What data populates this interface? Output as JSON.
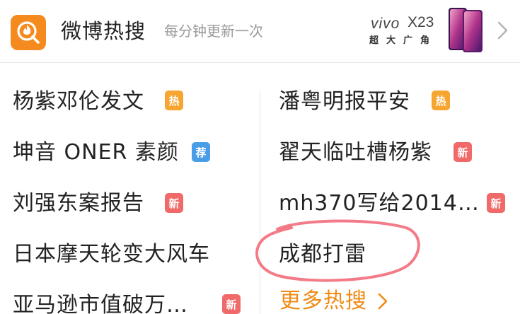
{
  "header": {
    "title": "微博热搜",
    "subtitle": "每分钟更新一次",
    "logo_icon": "weibo-search-flame-icon",
    "accent": "#f58a1f",
    "ad": {
      "brand": "vivo",
      "model": "X23",
      "tagline": "超大广角"
    }
  },
  "left_items": [
    {
      "text": "杨紫邓伦发文",
      "badge": "热",
      "badge_type": "hot"
    },
    {
      "text": "坤音 ONER 素颜",
      "badge": "荐",
      "badge_type": "rec"
    },
    {
      "text": "刘强东案报告",
      "badge": "新",
      "badge_type": "new"
    },
    {
      "text": "日本摩天轮变大风车",
      "badge": "",
      "badge_type": ""
    },
    {
      "text": "亚马逊市值破万…",
      "badge": "新",
      "badge_type": "new"
    }
  ],
  "right_items": [
    {
      "text": "潘粤明报平安",
      "badge": "热",
      "badge_type": "hot"
    },
    {
      "text": "翟天临吐槽杨紫",
      "badge": "新",
      "badge_type": "new"
    },
    {
      "text": "mh370写给2014…",
      "badge": "新",
      "badge_type": "new"
    },
    {
      "text": "成都打雷",
      "badge": "",
      "badge_type": ""
    }
  ],
  "more_label": "更多热搜",
  "colors": {
    "hot": "#f7a531",
    "rec": "#4a9ee8",
    "new": "#f06a6a",
    "more": "#f08a14",
    "annotation": "#f05a6a"
  }
}
